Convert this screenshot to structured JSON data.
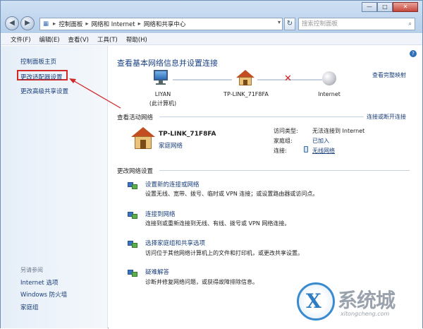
{
  "window": {
    "controls": {
      "minimize": "—",
      "maximize": "□",
      "close": "✕"
    }
  },
  "address_bar": {
    "crumbs": [
      "控制面板",
      "网络和 Internet",
      "网络和共享中心"
    ],
    "search_placeholder": "搜索控制面板"
  },
  "menu": [
    "文件(F)",
    "编辑(E)",
    "查看(V)",
    "工具(T)",
    "帮助(H)"
  ],
  "sidebar": {
    "items": [
      {
        "label": "控制面板主页"
      },
      {
        "label": "更改适配器设置",
        "highlighted": true
      },
      {
        "label": "更改高级共享设置"
      }
    ],
    "see_also": "另请参阅",
    "see_also_items": [
      "Internet 选项",
      "Windows 防火墙",
      "家庭组"
    ]
  },
  "main": {
    "title": "查看基本网络信息并设置连接",
    "full_map": "查看完整映射",
    "nodes": [
      {
        "line1": "LIYAN",
        "line2": "(此计算机)",
        "icon": "computer-icon"
      },
      {
        "line1": "TP-LINK_71F8FA",
        "line2": "",
        "icon": "house-icon"
      },
      {
        "line1": "Internet",
        "line2": "",
        "icon": "globe-icon"
      }
    ],
    "active_section": "查看活动网络",
    "connect_or_disconnect": "连接或断开连接",
    "active_network": {
      "name": "TP-LINK_71F8FA",
      "type": "家庭网络",
      "access_type_label": "访问类型:",
      "access_type_value": "无法连接到 Internet",
      "homegroup_label": "家庭组:",
      "homegroup_value": "已加入",
      "connections_label": "连接:",
      "connections_value": "无线网络"
    },
    "change_section": "更改网络设置",
    "tasks": [
      {
        "title": "设置新的连接或网络",
        "desc": "设置无线、宽带、拨号、临时或 VPN 连接；或设置路由器或访问点。"
      },
      {
        "title": "连接到网络",
        "desc": "连接到或重新连接到无线、有线、拨号或 VPN 网络连接。"
      },
      {
        "title": "选择家庭组和共享选项",
        "desc": "访问位于其他网络计算机上的文件和打印机，或更改共享设置。"
      },
      {
        "title": "疑难解答",
        "desc": "诊断并修复网络问题，或获得故障排除信息。"
      }
    ]
  },
  "watermark": {
    "text": "系统城",
    "url": "xitongcheng.com"
  },
  "colors": {
    "link": "#1a3e7a",
    "highlight_box": "#d12828",
    "title": "#1b4187"
  }
}
